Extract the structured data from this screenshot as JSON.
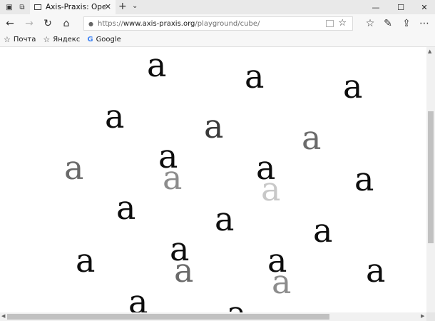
{
  "tabbar": {
    "tab_title": "Axis-Praxis: OpenType v",
    "close_glyph": "✕",
    "new_tab_glyph": "+",
    "tab_list_glyph": "⌄"
  },
  "window": {
    "minimize_glyph": "—",
    "maximize_glyph": "☐",
    "close_glyph": "✕"
  },
  "nav": {
    "back_glyph": "←",
    "forward_glyph": "→",
    "refresh_glyph": "↻",
    "home_glyph": "⌂",
    "lock_glyph": "🔒",
    "favorite_glyph": "☆",
    "hub_glyph": "☆",
    "notes_glyph": "✎",
    "share_glyph": "⇪",
    "more_glyph": "⋯"
  },
  "address": {
    "protocol": "https://",
    "host": "www.axis-praxis.org",
    "path": "/playground/cube/"
  },
  "favorites": [
    {
      "label": "Почта",
      "icon": "star-outline-icon",
      "glyph": "☆"
    },
    {
      "label": "Яндекс",
      "icon": "star-outline-icon",
      "glyph": "☆"
    },
    {
      "label": "Google",
      "icon": "google-icon",
      "glyph": "G"
    }
  ],
  "content": {
    "glyph_text": "a"
  },
  "colors": {
    "black": "#0d0d0d",
    "dark": "#3a3a3a",
    "mid": "#6a6a6a",
    "grey": "#8c8c8c",
    "light": "#c8c8c8"
  }
}
